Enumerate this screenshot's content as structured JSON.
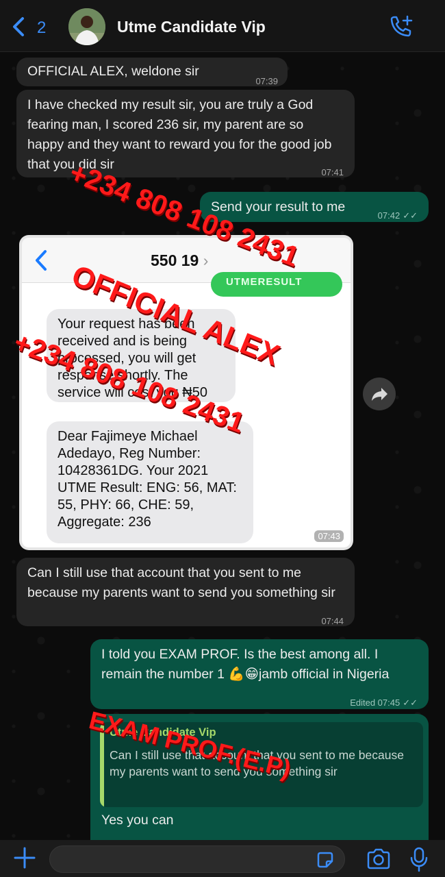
{
  "header": {
    "back_count": "2",
    "title": "Utme Candidate Vip"
  },
  "messages": {
    "m1": {
      "text": "OFFICIAL ALEX, weldone sir",
      "time": "07:39"
    },
    "m2": {
      "text": "I have checked my result sir, you are truly a God fearing man, I scored 236 sir, my parent are so happy and they want to reward you for the good job that you did sir",
      "time": "07:41"
    },
    "m3": {
      "text": "Send your result to me",
      "time": "07:42"
    },
    "m5": {
      "text": "Can I still use that account that you sent to me because my parents want to send you something sir",
      "time": "07:44"
    },
    "m6": {
      "text": "I told you EXAM PROF. Is the best among all. I remain the number 1 💪😁jamb official in Nigeria",
      "time": "Edited 07:45"
    },
    "m7": {
      "text": "Yes you can"
    }
  },
  "screenshot": {
    "sender_number": "550 19",
    "pill_text": "UTMERESULT",
    "sms1": "Your request has been received and is being processed, you will get response shortly. The service will cost you ₦50",
    "sms2": "Dear Fajimeye Michael Adedayo, Reg Number: 10428361DG. Your 2021 UTME Result: ENG: 56, MAT: 55, PHY: 66, CHE: 59, Aggregate: 236",
    "time": "07:43"
  },
  "quote": {
    "name": "Utme Candidate Vip",
    "text": "Can I still use that account that you sent to me because my parents want to send you something sir"
  },
  "watermarks": {
    "phone1": "+234 808 108 2431",
    "official": "OFFICIAL ALEX",
    "phone2": "+234 808 108 2431",
    "exam": "EXAM PROF.(E.P)"
  },
  "icons": [
    "chevron-left-icon",
    "phone-add-icon",
    "share-icon",
    "plus-icon",
    "sticker-icon",
    "camera-icon",
    "mic-icon"
  ],
  "colors": {
    "accent": "#3b8cf7",
    "outgoing": "#085443",
    "incoming": "#252525",
    "watermark": "#ff1a1a"
  }
}
